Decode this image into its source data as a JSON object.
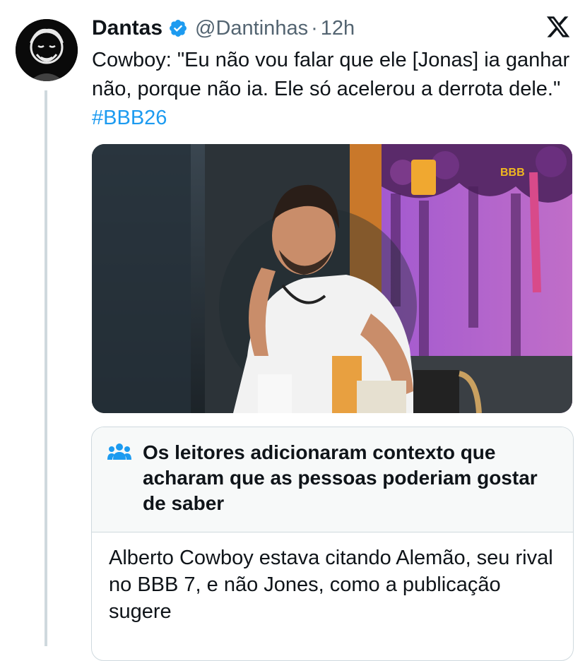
{
  "author": {
    "name": "Dantas",
    "handle": "@Dantinhas",
    "separator": "·",
    "time": "12h"
  },
  "icons": {
    "verified": "verified-badge-icon",
    "platform": "x-logo-icon",
    "note": "community-notes-icon"
  },
  "tweet": {
    "text": "Cowboy: \"Eu não vou falar que ele [Jonas] ia ganhar não, porque não ia. Ele só acelerou a derrota dele.\"",
    "hashtag": "#BBB26"
  },
  "media": {
    "watermark": "BBB"
  },
  "community_note": {
    "title": "Os leitores adicionaram contexto que acharam que as pessoas poderiam gostar de saber",
    "body": "Alberto Cowboy estava citando Alemão, seu rival no BBB 7, e não Jones, como a publicação sugere"
  },
  "colors": {
    "accent": "#1d9bf0",
    "text": "#0f1419",
    "secondary": "#536471",
    "border": "#cfd9de"
  }
}
